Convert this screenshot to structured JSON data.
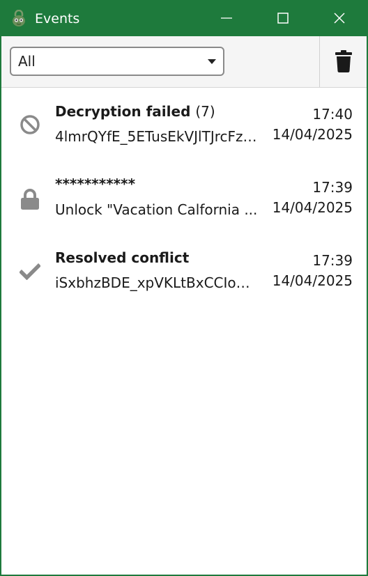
{
  "window": {
    "title": "Events",
    "accent_color": "#1e7a3c"
  },
  "toolbar": {
    "filter_value": "All"
  },
  "events": [
    {
      "icon": "blocked-icon",
      "title": "Decryption failed",
      "count": "(7)",
      "subtitle": "4lmrQYfE_5ETusEkVJlTJrcFzj...",
      "time": "17:40",
      "date": "14/04/2025"
    },
    {
      "icon": "lock-icon",
      "title": "***********",
      "count": "",
      "subtitle": "Unlock \"Vacation Calfornia ...",
      "time": "17:39",
      "date": "14/04/2025"
    },
    {
      "icon": "checkmark-icon",
      "title": "Resolved conflict",
      "count": "",
      "subtitle": "iSxbhzBDE_xpVKLtBxCCIo0s...",
      "time": "17:39",
      "date": "14/04/2025"
    }
  ]
}
